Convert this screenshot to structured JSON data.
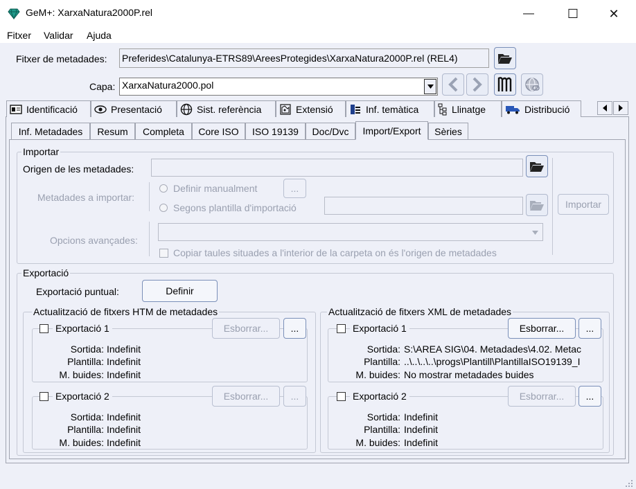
{
  "window": {
    "title": "GeM+: XarxaNatura2000P.rel",
    "minimize": "—",
    "maximize": "☐",
    "close": "✕"
  },
  "menu": [
    "Fitxer",
    "Validar",
    "Ajuda"
  ],
  "metadata_file": {
    "label": "Fitxer de metadades:",
    "value": "Preferides\\Catalunya-ETRS89\\AreesProtegides\\XarxaNatura2000P.rel (REL4)"
  },
  "layer": {
    "label": "Capa:",
    "value": "XarxaNatura2000.pol"
  },
  "main_tabs": [
    "Identificació",
    "Presentació",
    "Sist. referència",
    "Extensió",
    "Inf. temàtica",
    "Llinatge",
    "Distribució"
  ],
  "sub_tabs": [
    "Inf. Metadades",
    "Resum",
    "Completa",
    "Core ISO",
    "ISO 19139",
    "Doc/Dvc",
    "Import/Export",
    "Sèries"
  ],
  "active_sub_tab": "Import/Export",
  "import": {
    "title": "Importar",
    "origin_label": "Origen de les metadades:",
    "origin_value": "",
    "to_import_label": "Metadades a importar:",
    "radio_manual": "Definir manualment",
    "radio_template": "Segons plantilla d'importació",
    "ellipsis": "...",
    "import_button": "Importar",
    "advanced_label": "Opcions avançades:",
    "copy_tables": "Copiar taules situades a l'interior de la carpeta on és l'origen de metadades"
  },
  "export": {
    "title": "Exportació",
    "punctual_label": "Exportació puntual:",
    "define_button": "Definir",
    "htm": {
      "title": "Actualització de fitxers HTM de metadades",
      "items": [
        {
          "name": "Exportació 1",
          "output_label": "Sortida:",
          "output": "Indefinit",
          "template_label": "Plantilla:",
          "template": "Indefinit",
          "empty_label": "M. buides:",
          "empty": "Indefinit",
          "delete": "Esborrar...",
          "ellipsis": "..."
        },
        {
          "name": "Exportació 2",
          "output_label": "Sortida:",
          "output": "Indefinit",
          "template_label": "Plantilla:",
          "template": "Indefinit",
          "empty_label": "M. buides:",
          "empty": "Indefinit",
          "delete": "Esborrar...",
          "ellipsis": "..."
        }
      ]
    },
    "xml": {
      "title": "Actualització de fitxers XML de metadades",
      "items": [
        {
          "name": "Exportació 1",
          "output_label": "Sortida:",
          "output": "S:\\AREA SIG\\04. Metadades\\4.02. Metac",
          "template_label": "Plantilla:",
          "template": "..\\..\\..\\..\\progs\\Plantill\\PlantillaISO19139_I",
          "empty_label": "M. buides:",
          "empty": "No mostrar metadades buides",
          "delete": "Esborrar...",
          "ellipsis": "..."
        },
        {
          "name": "Exportació 2",
          "output_label": "Sortida:",
          "output": "Indefinit",
          "template_label": "Plantilla:",
          "template": "Indefinit",
          "empty_label": "M. buides:",
          "empty": "Indefinit",
          "delete": "Esborrar...",
          "ellipsis": "..."
        }
      ]
    }
  },
  "colors": {
    "background": "#eef0f8",
    "accent": "#2a58b8"
  }
}
